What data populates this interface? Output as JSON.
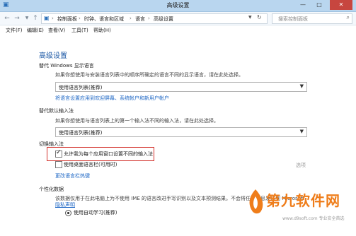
{
  "window": {
    "title": "高级设置",
    "controls": {
      "minimize": "—",
      "maximize": "□",
      "close": "✕"
    }
  },
  "address_bar": {
    "breadcrumb": [
      "控制面板",
      "时钟、语言和区域",
      "语言",
      "高级设置"
    ],
    "search_placeholder": "搜索控制面板"
  },
  "menu": [
    "文件(F)",
    "编辑(E)",
    "查看(V)",
    "工具(T)",
    "帮助(H)"
  ],
  "content": {
    "title": "高级设置",
    "override_display": {
      "heading": "替代 Windows 显示语言",
      "desc": "如果你想使用与安装语言列表中的顺序所确定的语言不同的显示语言，请在此处选择。",
      "selected": "使用语言列表(推荐)",
      "link": "将语言设置应用到欢迎屏幕、系统帐户和新用户帐户"
    },
    "override_input": {
      "heading": "替代默认输入法",
      "desc": "如果你想使用与语言列表上的第一个输入法不同的输入法，请在此处选择。",
      "selected": "使用语言列表(推荐)"
    },
    "switching": {
      "heading": "切换输入法",
      "option1": "允许我为每个应用窗口设置不同的输入法",
      "option1_checked": true,
      "option2": "使用桌面语言栏(可用时)",
      "option2_checked": false,
      "options_link": "选项",
      "hotkeys_link": "更改语言栏热键"
    },
    "personalization": {
      "heading": "个性化数据",
      "desc": "该数据仅用于在此电脑上为不使用 IME 的语言改进手写识别以及文本预测结果。不会将任何信息发送到 Microsoft",
      "privacy_link": "隐私声明",
      "radio_label": "使用自动学习(推荐)"
    }
  },
  "watermark": {
    "text": "第九软件网",
    "url": "www.d9soft.com 专业安全首选"
  },
  "colors": {
    "title_bar": "#b9d6ef",
    "heading_blue": "#1e5aa6",
    "link_blue": "#1e67c5",
    "highlight_red": "#d3322c",
    "watermark_orange": "#ef7d1a"
  }
}
